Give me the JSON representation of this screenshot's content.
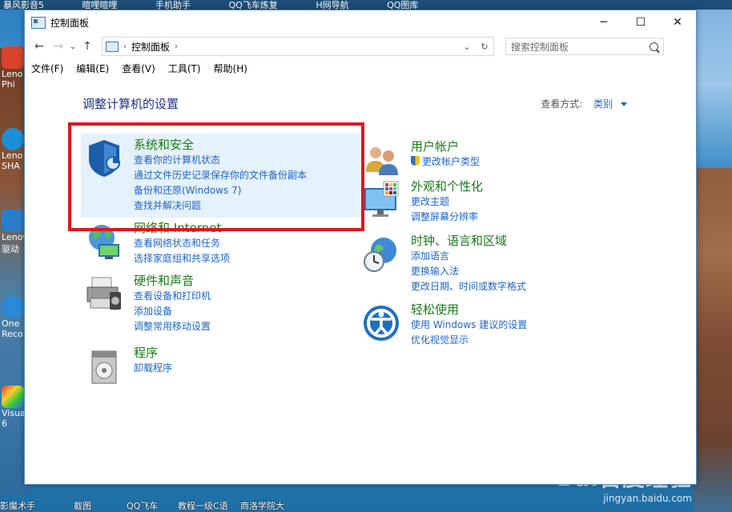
{
  "desktop": {
    "top_labels": [
      "暴风影音5",
      "暄哩暄哩",
      "手机助手",
      "QQ飞车炼复",
      "H网导航",
      "QQ图库"
    ],
    "left_icon_labels": [
      "Leno Phi",
      "Leno SHA",
      "Lenov 驱动",
      "One Reco",
      "Visua 6"
    ],
    "bottom_labels": [
      "影魔术手",
      "截图",
      "QQ飞车",
      "教程一级C语",
      "商洛学院大"
    ]
  },
  "watermark": {
    "brand": "Bai百度经验",
    "url": "jingyan.baidu.com"
  },
  "window": {
    "title": "控制面板",
    "controls": {
      "minimize": "─",
      "maximize": "☐",
      "close": "✕"
    }
  },
  "address": {
    "back": "←",
    "forward": "→",
    "recent": "⌄",
    "up": "↑",
    "separator": "›",
    "path": "控制面板",
    "dropdown": "⌄",
    "refresh": "↻",
    "search_placeholder": "搜索控制面板"
  },
  "menu": [
    "文件(F)",
    "编辑(E)",
    "查看(V)",
    "工具(T)",
    "帮助(H)"
  ],
  "main": {
    "heading": "调整计算机的设置",
    "view_by_label": "查看方式:",
    "view_by_value": "类别"
  },
  "categories_left": [
    {
      "title": "系统和安全",
      "links": [
        "查看你的计算机状态",
        "通过文件历史记录保存你的文件备份副本",
        "备份和还原(Windows 7)",
        "查找并解决问题"
      ]
    },
    {
      "title": "网络和 Internet",
      "links": [
        "查看网络状态和任务",
        "选择家庭组和共享选项"
      ]
    },
    {
      "title": "硬件和声音",
      "links": [
        "查看设备和打印机",
        "添加设备",
        "调整常用移动设置"
      ]
    },
    {
      "title": "程序",
      "links": [
        "卸载程序"
      ]
    }
  ],
  "categories_right": [
    {
      "title": "用户帐户",
      "links": [
        "更改帐户类型"
      ]
    },
    {
      "title": "外观和个性化",
      "links": [
        "更改主题",
        "调整屏幕分辨率"
      ]
    },
    {
      "title": "时钟、语言和区域",
      "links": [
        "添加语言",
        "更换输入法",
        "更改日期、时间或数字格式"
      ]
    },
    {
      "title": "轻松使用",
      "links": [
        "使用 Windows 建议的设置",
        "优化视觉显示"
      ]
    }
  ],
  "colors": {
    "category_title": "#1a7a1a",
    "link": "#1e64c8",
    "heading": "#1e3287",
    "highlight": "#e5f1fb",
    "annotation_box": "#e5141b"
  }
}
